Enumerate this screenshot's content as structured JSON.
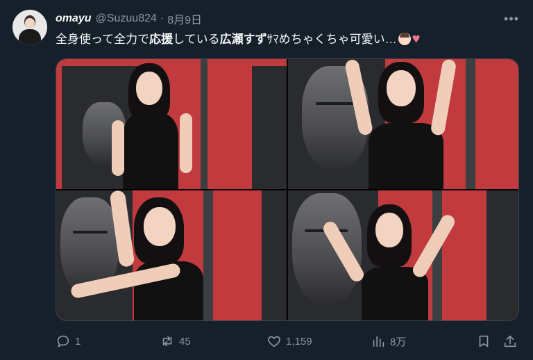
{
  "tweet": {
    "author_name": "omayu",
    "handle": "@Suzuu824",
    "separator": "·",
    "date": "8月9日",
    "more_icon": "more-dots-icon",
    "text": {
      "part1": "全身使って全力で",
      "bold1": "応援",
      "part2": "している",
      "bold2": "広瀬すず",
      "part3": "ｻﾏめちゃくちゃ可愛い…"
    },
    "heart_glyph": "♥"
  },
  "colors": {
    "background": "#15202b",
    "secondary_text": "#8b98a5",
    "poster_red": "#c13a3e",
    "heart": "#f9768f"
  },
  "actions": {
    "reply": {
      "icon": "reply-icon",
      "count": "1"
    },
    "retweet": {
      "icon": "retweet-icon",
      "count": "45"
    },
    "like": {
      "icon": "like-icon",
      "count": "1,159"
    },
    "views": {
      "icon": "views-icon",
      "count": "8万"
    },
    "bookmark": {
      "icon": "bookmark-icon"
    },
    "share": {
      "icon": "share-icon"
    }
  }
}
